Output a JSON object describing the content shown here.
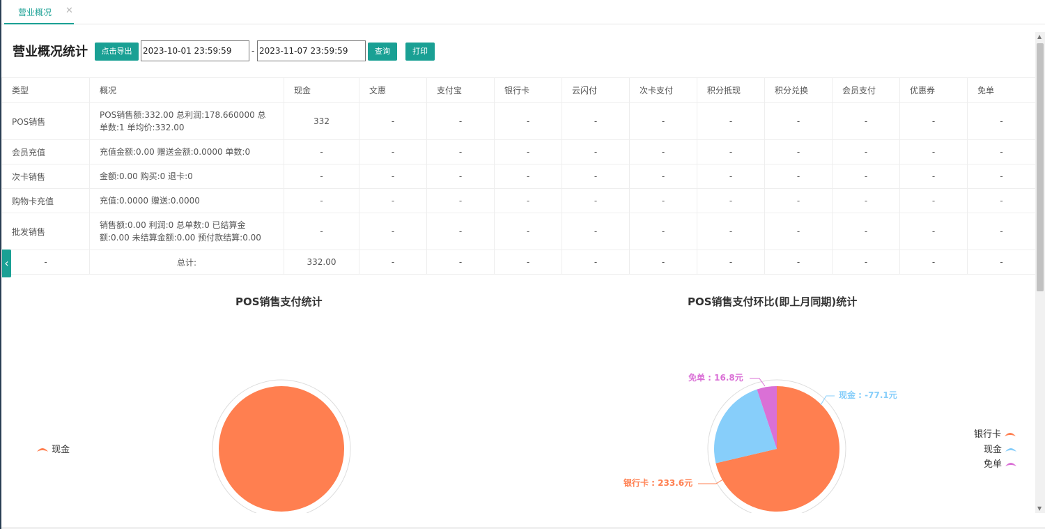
{
  "tab": {
    "label": "营业概况",
    "close": "✕"
  },
  "header": {
    "title": "营业概况统计",
    "export_label": "点击导出",
    "start_date": "2023-10-01 23:59:59",
    "separator": "-",
    "end_date": "2023-11-07 23:59:59",
    "query_label": "查询",
    "print_label": "打印"
  },
  "table": {
    "columns": [
      "类型",
      "概况",
      "现金",
      "文惠",
      "支付宝",
      "银行卡",
      "云闪付",
      "次卡支付",
      "积分抵现",
      "积分兑换",
      "会员支付",
      "优惠券",
      "免单"
    ],
    "rows": [
      {
        "type": "POS销售",
        "desc": "POS销售额:332.00 总利润:178.660000 总单数:1 单均价:332.00",
        "cells": [
          "332",
          "-",
          "-",
          "-",
          "-",
          "-",
          "-",
          "-",
          "-",
          "-",
          "-"
        ]
      },
      {
        "type": "会员充值",
        "desc": "充值金额:0.00 赠送金额:0.0000 单数:0",
        "cells": [
          "-",
          "-",
          "-",
          "-",
          "-",
          "-",
          "-",
          "-",
          "-",
          "-",
          "-"
        ]
      },
      {
        "type": "次卡销售",
        "desc": "金额:0.00 购买:0 退卡:0",
        "cells": [
          "-",
          "-",
          "-",
          "-",
          "-",
          "-",
          "-",
          "-",
          "-",
          "-",
          "-"
        ]
      },
      {
        "type": "购物卡充值",
        "desc": "充值:0.0000 赠送:0.0000",
        "cells": [
          "-",
          "-",
          "-",
          "-",
          "-",
          "-",
          "-",
          "-",
          "-",
          "-",
          "-"
        ]
      },
      {
        "type": "批发销售",
        "desc": "销售额:0.00 利润:0 总单数:0 已结算金额:0.00 未结算金额:0.00 预付款结算:0.00",
        "cells": [
          "-",
          "-",
          "-",
          "-",
          "-",
          "-",
          "-",
          "-",
          "-",
          "-",
          "-"
        ]
      },
      {
        "type": "-",
        "desc": "总计:",
        "cells": [
          "332.00",
          "-",
          "-",
          "-",
          "-",
          "-",
          "-",
          "-",
          "-",
          "-",
          "-"
        ]
      }
    ]
  },
  "colors": {
    "accent": "#1aa094",
    "orange": "#ff7f50",
    "blue": "#87cefa",
    "purple": "#da70d6"
  },
  "icons": {
    "close": "close-icon",
    "collapse": "chevron-left-icon"
  },
  "chart_data": [
    {
      "type": "pie",
      "title": "POS销售支付统计",
      "legend": [
        "现金"
      ],
      "slices": [
        {
          "name": "现金",
          "value": 332,
          "color": "#ff7f50"
        }
      ]
    },
    {
      "type": "pie",
      "title": "POS销售支付环比(即上月同期)统计",
      "legend": [
        "银行卡",
        "现金",
        "免单"
      ],
      "slices": [
        {
          "name": "银行卡",
          "value": 233.6,
          "color": "#ff7f50",
          "label": "银行卡 : 233.6元"
        },
        {
          "name": "现金",
          "value": -77.1,
          "color": "#87cefa",
          "label": "现金 : -77.1元"
        },
        {
          "name": "免单",
          "value": 16.8,
          "color": "#da70d6",
          "label": "免单 : 16.8元"
        }
      ]
    }
  ]
}
